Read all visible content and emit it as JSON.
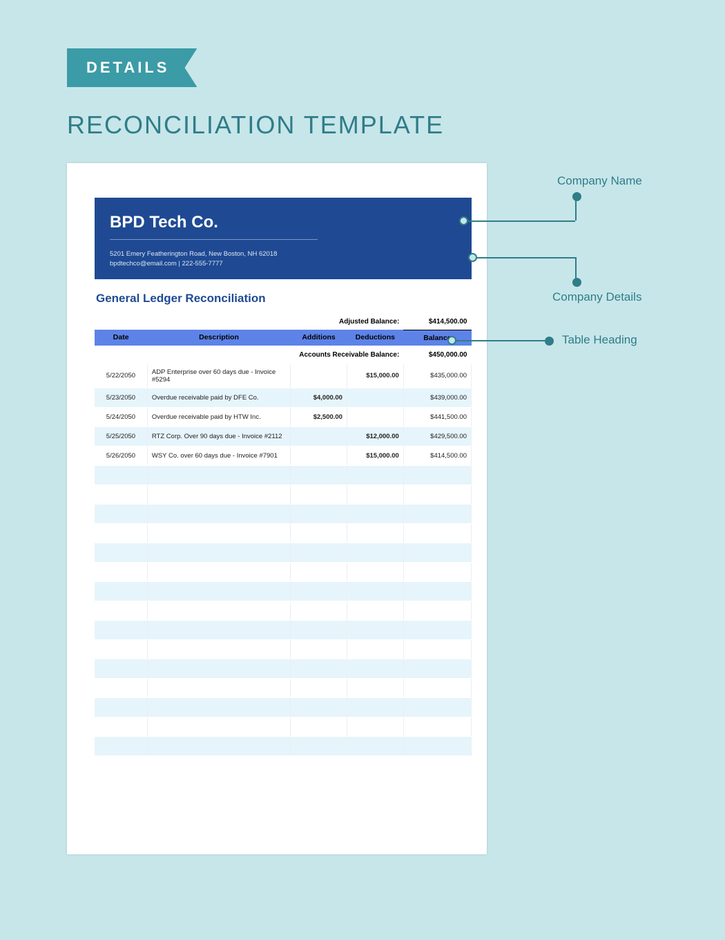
{
  "ribbon": {
    "label": "DETAILS"
  },
  "page": {
    "title": "RECONCILIATION TEMPLATE"
  },
  "company": {
    "name": "BPD Tech Co.",
    "address": "5201 Emery Featherington Road, New Boston, NH 62018",
    "contact": "bpdtechco@email.com | 222-555-7777"
  },
  "section": {
    "title": "General Ledger Reconciliation"
  },
  "adjusted": {
    "label": "Adjusted Balance:",
    "value": "$414,500.00"
  },
  "columns": {
    "date": "Date",
    "description": "Description",
    "additions": "Additions",
    "deductions": "Deductions",
    "balance": "Balance"
  },
  "ar": {
    "label": "Accounts Receivable Balance:",
    "value": "$450,000.00"
  },
  "rows": [
    {
      "date": "5/22/2050",
      "description": "ADP Enterprise over 60 days due - Invoice #5294",
      "additions": "",
      "deductions": "$15,000.00",
      "balance": "$435,000.00"
    },
    {
      "date": "5/23/2050",
      "description": "Overdue receivable paid by DFE Co.",
      "additions": "$4,000.00",
      "deductions": "",
      "balance": "$439,000.00"
    },
    {
      "date": "5/24/2050",
      "description": "Overdue receivable paid by HTW Inc.",
      "additions": "$2,500.00",
      "deductions": "",
      "balance": "$441,500.00"
    },
    {
      "date": "5/25/2050",
      "description": "RTZ Corp. Over 90 days due - Invoice #2112",
      "additions": "",
      "deductions": "$12,000.00",
      "balance": "$429,500.00"
    },
    {
      "date": "5/26/2050",
      "description": "WSY Co. over 60 days due - Invoice #7901",
      "additions": "",
      "deductions": "$15,000.00",
      "balance": "$414,500.00"
    }
  ],
  "empty_row_count": 15,
  "annotations": {
    "company_name": "Company Name",
    "company_details": "Company Details",
    "table_heading": "Table Heading"
  }
}
